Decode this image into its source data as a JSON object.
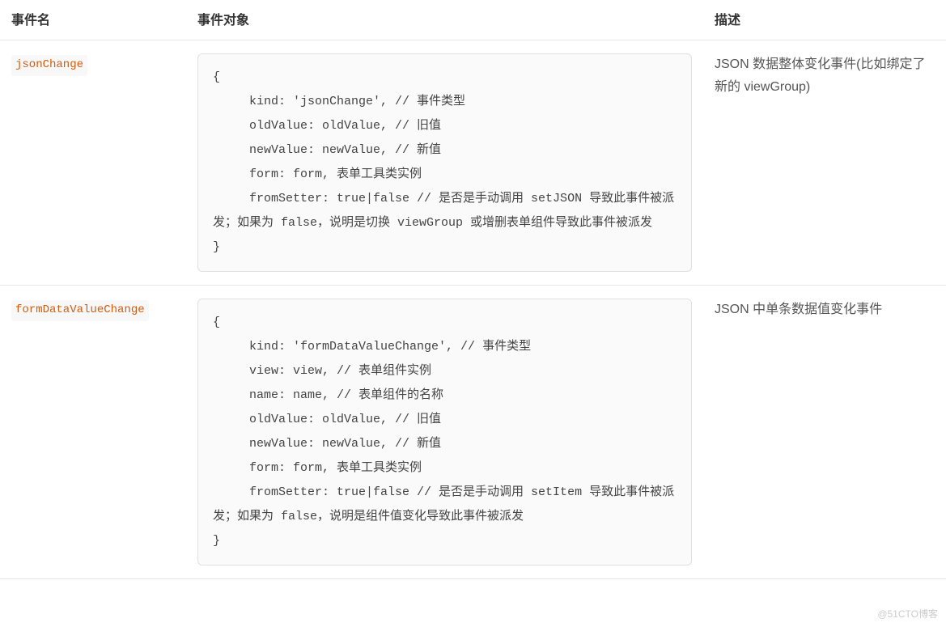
{
  "headers": {
    "name": "事件名",
    "object": "事件对象",
    "desc": "描述"
  },
  "rows": [
    {
      "name": "jsonChange",
      "code": "{\n     kind: 'jsonChange', // 事件类型\n     oldValue: oldValue, // 旧值\n     newValue: newValue, // 新值\n     form: form, 表单工具类实例\n     fromSetter: true|false // 是否是手动调用 setJSON 导致此事件被派发；如果为 false，说明是切换 viewGroup 或增删表单组件导致此事件被派发\n}",
      "desc": "JSON 数据整体变化事件(比如绑定了新的 viewGroup)"
    },
    {
      "name": "formDataValueChange",
      "code": "{\n     kind: 'formDataValueChange', // 事件类型\n     view: view, // 表单组件实例\n     name: name, // 表单组件的名称\n     oldValue: oldValue, // 旧值\n     newValue: newValue, // 新值\n     form: form, 表单工具类实例\n     fromSetter: true|false // 是否是手动调用 setItem 导致此事件被派发；如果为 false，说明是组件值变化导致此事件被派发\n}",
      "desc": "JSON 中单条数据值变化事件"
    }
  ],
  "watermark": "@51CTO博客"
}
